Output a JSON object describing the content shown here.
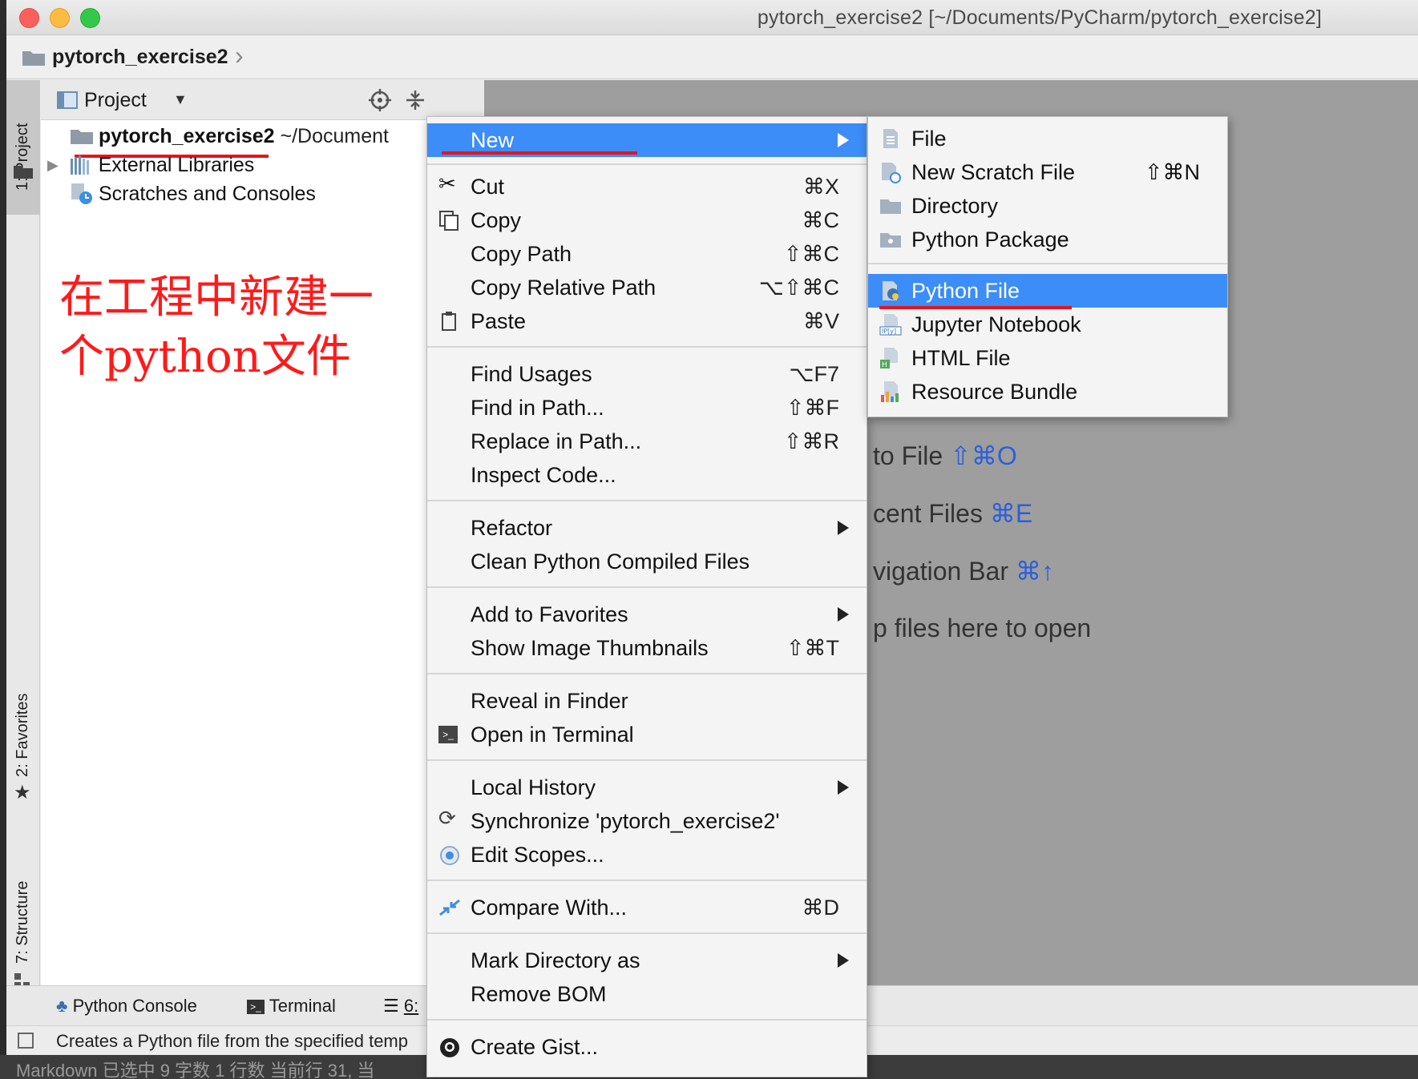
{
  "window": {
    "title": "pytorch_exercise2 [~/Documents/PyCharm/pytorch_exercise2]"
  },
  "navbar": {
    "crumb": "pytorch_exercise2"
  },
  "toolstrip": {
    "project_tab": "1: Project",
    "favorites_tab": "2: Favorites",
    "structure_tab": "7: Structure"
  },
  "project_panel": {
    "title": "Project",
    "tree": [
      {
        "label": "pytorch_exercise2",
        "path": "~/Document"
      },
      {
        "label": "External Libraries"
      },
      {
        "label": "Scratches and Consoles"
      }
    ]
  },
  "annotation": {
    "line1": "在工程中新建一",
    "line2": "个python文件"
  },
  "editor_hints": [
    {
      "label": "to File",
      "shortcut": "⇧⌘O"
    },
    {
      "label": "cent Files",
      "shortcut": "⌘E"
    },
    {
      "label": "vigation Bar",
      "shortcut": "⌘↑"
    },
    {
      "label": "p files here to open",
      "shortcut": ""
    }
  ],
  "bottombar": {
    "python_console": "Python Console",
    "terminal": "Terminal",
    "todo": "6:"
  },
  "status": {
    "text": "Creates a Python file from the specified temp",
    "under": "Markdown 已选中  9 字数  1 行数  当前行 31, 当"
  },
  "context_menu": {
    "items": [
      {
        "label": "New",
        "shortcut": "",
        "submenu": true
      },
      {
        "label": "Cut",
        "shortcut": "⌘X"
      },
      {
        "label": "Copy",
        "shortcut": "⌘C"
      },
      {
        "label": "Copy Path",
        "shortcut": "⇧⌘C"
      },
      {
        "label": "Copy Relative Path",
        "shortcut": "⌥⇧⌘C"
      },
      {
        "label": "Paste",
        "shortcut": "⌘V"
      },
      {
        "label": "Find Usages",
        "shortcut": "⌥F7"
      },
      {
        "label": "Find in Path...",
        "shortcut": "⇧⌘F"
      },
      {
        "label": "Replace in Path...",
        "shortcut": "⇧⌘R"
      },
      {
        "label": "Inspect Code...",
        "shortcut": ""
      },
      {
        "label": "Refactor",
        "shortcut": "",
        "submenu": true
      },
      {
        "label": "Clean Python Compiled Files",
        "shortcut": ""
      },
      {
        "label": "Add to Favorites",
        "shortcut": "",
        "submenu": true
      },
      {
        "label": "Show Image Thumbnails",
        "shortcut": "⇧⌘T"
      },
      {
        "label": "Reveal in Finder",
        "shortcut": ""
      },
      {
        "label": "Open in Terminal",
        "shortcut": ""
      },
      {
        "label": "Local History",
        "shortcut": "",
        "submenu": true
      },
      {
        "label": "Synchronize 'pytorch_exercise2'",
        "shortcut": ""
      },
      {
        "label": "Edit Scopes...",
        "shortcut": ""
      },
      {
        "label": "Compare With...",
        "shortcut": "⌘D"
      },
      {
        "label": "Mark Directory as",
        "shortcut": "",
        "submenu": true
      },
      {
        "label": "Remove BOM",
        "shortcut": ""
      },
      {
        "label": "Create Gist...",
        "shortcut": ""
      }
    ]
  },
  "submenu": {
    "items": [
      {
        "label": "File",
        "shortcut": ""
      },
      {
        "label": "New Scratch File",
        "shortcut": "⇧⌘N"
      },
      {
        "label": "Directory",
        "shortcut": ""
      },
      {
        "label": "Python Package",
        "shortcut": ""
      },
      {
        "label": "Python File",
        "shortcut": ""
      },
      {
        "label": "Jupyter Notebook",
        "shortcut": ""
      },
      {
        "label": "HTML File",
        "shortcut": ""
      },
      {
        "label": "Resource Bundle",
        "shortcut": ""
      }
    ]
  },
  "colors": {
    "selection": "#3c8df7",
    "annotation": "#ff1a1a",
    "shortcut_hint": "#2d5fd8"
  }
}
